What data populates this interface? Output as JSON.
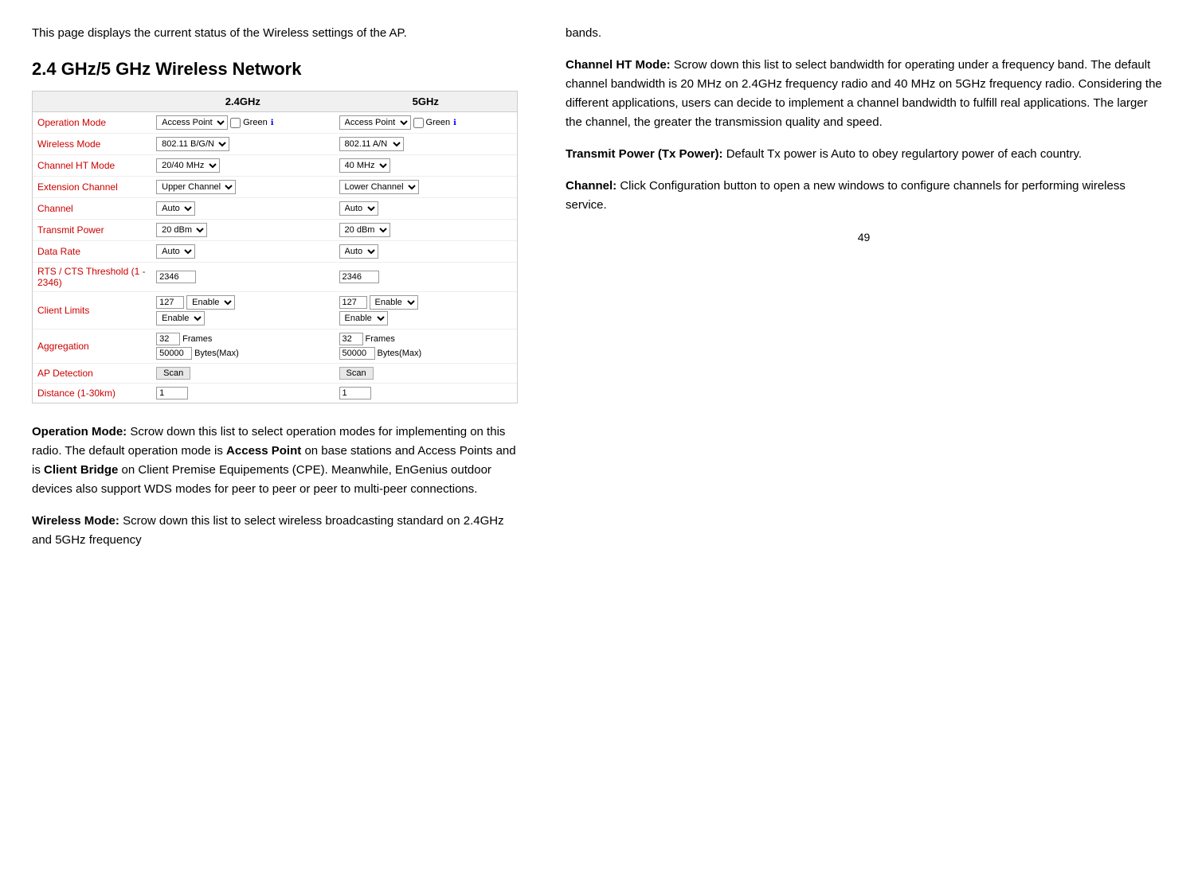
{
  "left": {
    "intro": "This  page  displays  the  current  status  of  the  Wireless settings of the AP.",
    "section_heading": "2.4 GHz/5 GHz Wireless Network",
    "table": {
      "col_24_header": "2.4GHz",
      "col_5_header": "5GHz",
      "rows": [
        {
          "label": "Operation Mode",
          "val_24": "Access Point",
          "val_24_extra": "Green",
          "val_5": "Access Point",
          "val_5_extra": "Green",
          "type": "select_green"
        },
        {
          "label": "Wireless Mode",
          "val_24": "802.11 B/G/N",
          "val_5": "802.11 A/N",
          "type": "select"
        },
        {
          "label": "Channel HT Mode",
          "val_24": "20/40 MHz",
          "val_5": "40 MHz",
          "type": "select"
        },
        {
          "label": "Extension Channel",
          "val_24": "Upper Channel",
          "val_5": "Lower Channel",
          "type": "select_small"
        },
        {
          "label": "Channel",
          "val_24": "Auto",
          "val_5": "Auto",
          "type": "select"
        },
        {
          "label": "Transmit Power",
          "val_24": "20 dBm",
          "val_5": "20 dBm",
          "type": "select"
        },
        {
          "label": "Data Rate",
          "val_24": "Auto",
          "val_5": "Auto",
          "type": "select"
        },
        {
          "label": "RTS / CTS Threshold (1 - 2346)",
          "val_24": "2346",
          "val_5": "2346",
          "type": "input"
        },
        {
          "label": "Client Limits",
          "val_24_num": "127",
          "val_24_sel": "Enable",
          "val_24_sel2": "Enable",
          "val_5_num": "127",
          "val_5_sel": "Enable",
          "val_5_sel2": "Enable",
          "type": "client_limits"
        },
        {
          "label": "Aggregation",
          "val_24_num": "32",
          "val_24_frames": "Frames",
          "val_24_bytes": "50000",
          "val_24_byteslabel": "Bytes(Max)",
          "val_5_num": "32",
          "val_5_frames": "Frames",
          "val_5_bytes": "50000",
          "val_5_byteslabel": "Bytes(Max)",
          "type": "aggregation"
        },
        {
          "label": "AP Detection",
          "val_24_btn": "Scan",
          "val_5_btn": "Scan",
          "type": "scan"
        },
        {
          "label": "Distance (1-30km)",
          "val_24": "1",
          "val_5": "1",
          "type": "input_small"
        }
      ]
    }
  },
  "right": {
    "paragraphs": [
      {
        "id": "bands",
        "text": "bands."
      },
      {
        "id": "channel_ht",
        "term": "Channel HT Mode:",
        "text": " Scrow down this list to select bandwidth for operating under a frequency band. The default channel bandwidth is 20 MHz on 2.4GHz frequency radio and 40 MHz on 5GHz frequency radio. Considering the different applications, users can decide to implement a channel bandwidth to fulfill real applications. The larger the channel, the greater the transmission quality and speed."
      },
      {
        "id": "tx_power",
        "term": "Transmit Power (Tx Power):",
        "text": " Default Tx power is Auto to obey regulartory power of each country."
      },
      {
        "id": "channel",
        "term": "Channel:",
        "text": "  Click  Configuration  button  to  open  a  new windows to configure channels for performing wireless service."
      }
    ],
    "operation_mode_para": {
      "term": "Operation Mode:",
      "text": " Scrow down this list to select operation modes for implementing on this radio. The default operation mode is ",
      "term2": "Access Point",
      "text2": " on base stations and Access Points and is ",
      "term3": "Client Bridge",
      "text3": " on Client Premise Equipements (CPE). Meanwhile, EnGenius outdoor devices also support WDS modes for peer to peer or peer to multi-peer connections."
    },
    "wireless_mode_para": {
      "term": "Wireless Mode:",
      "text": " Scrow down this list to select wireless broadcasting standard on 2.4GHz and 5GHz frequency"
    }
  },
  "page_number": "49"
}
